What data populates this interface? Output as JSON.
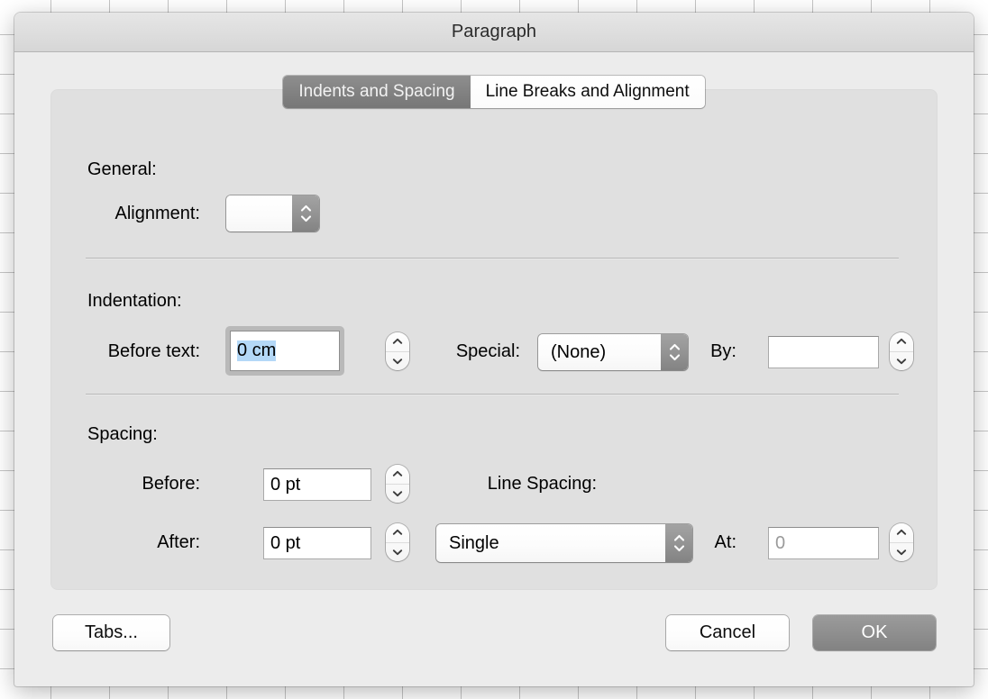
{
  "window": {
    "title": "Paragraph"
  },
  "tabs": [
    {
      "label": "Indents and Spacing",
      "active": true
    },
    {
      "label": "Line Breaks and Alignment",
      "active": false
    }
  ],
  "sections": {
    "general": {
      "title": "General:",
      "alignment": {
        "label": "Alignment:",
        "value": "",
        "stepper": "alignment-popup-chevrons"
      }
    },
    "indentation": {
      "title": "Indentation:",
      "before_text": {
        "label": "Before text:",
        "value": "0 cm",
        "focused": true,
        "selected": true
      },
      "special": {
        "label": "Special:",
        "value": "(None)"
      },
      "by": {
        "label": "By:",
        "value": "",
        "placeholder": ""
      }
    },
    "spacing": {
      "title": "Spacing:",
      "before": {
        "label": "Before:",
        "value": "0 pt"
      },
      "after": {
        "label": "After:",
        "value": "0 pt"
      },
      "line_spacing": {
        "label": "Line Spacing:",
        "value": "Single"
      },
      "at": {
        "label": "At:",
        "value": "0",
        "disabled": true
      }
    }
  },
  "buttons": {
    "tabs": "Tabs...",
    "cancel": "Cancel",
    "ok": "OK"
  },
  "colors": {
    "accent_selection": "#b4d8f7",
    "dialog_bg": "#ececec",
    "panel_bg": "#e0e0e0",
    "tab_active_bg": "#828282",
    "default_button_bg": "#8f8f8f"
  }
}
